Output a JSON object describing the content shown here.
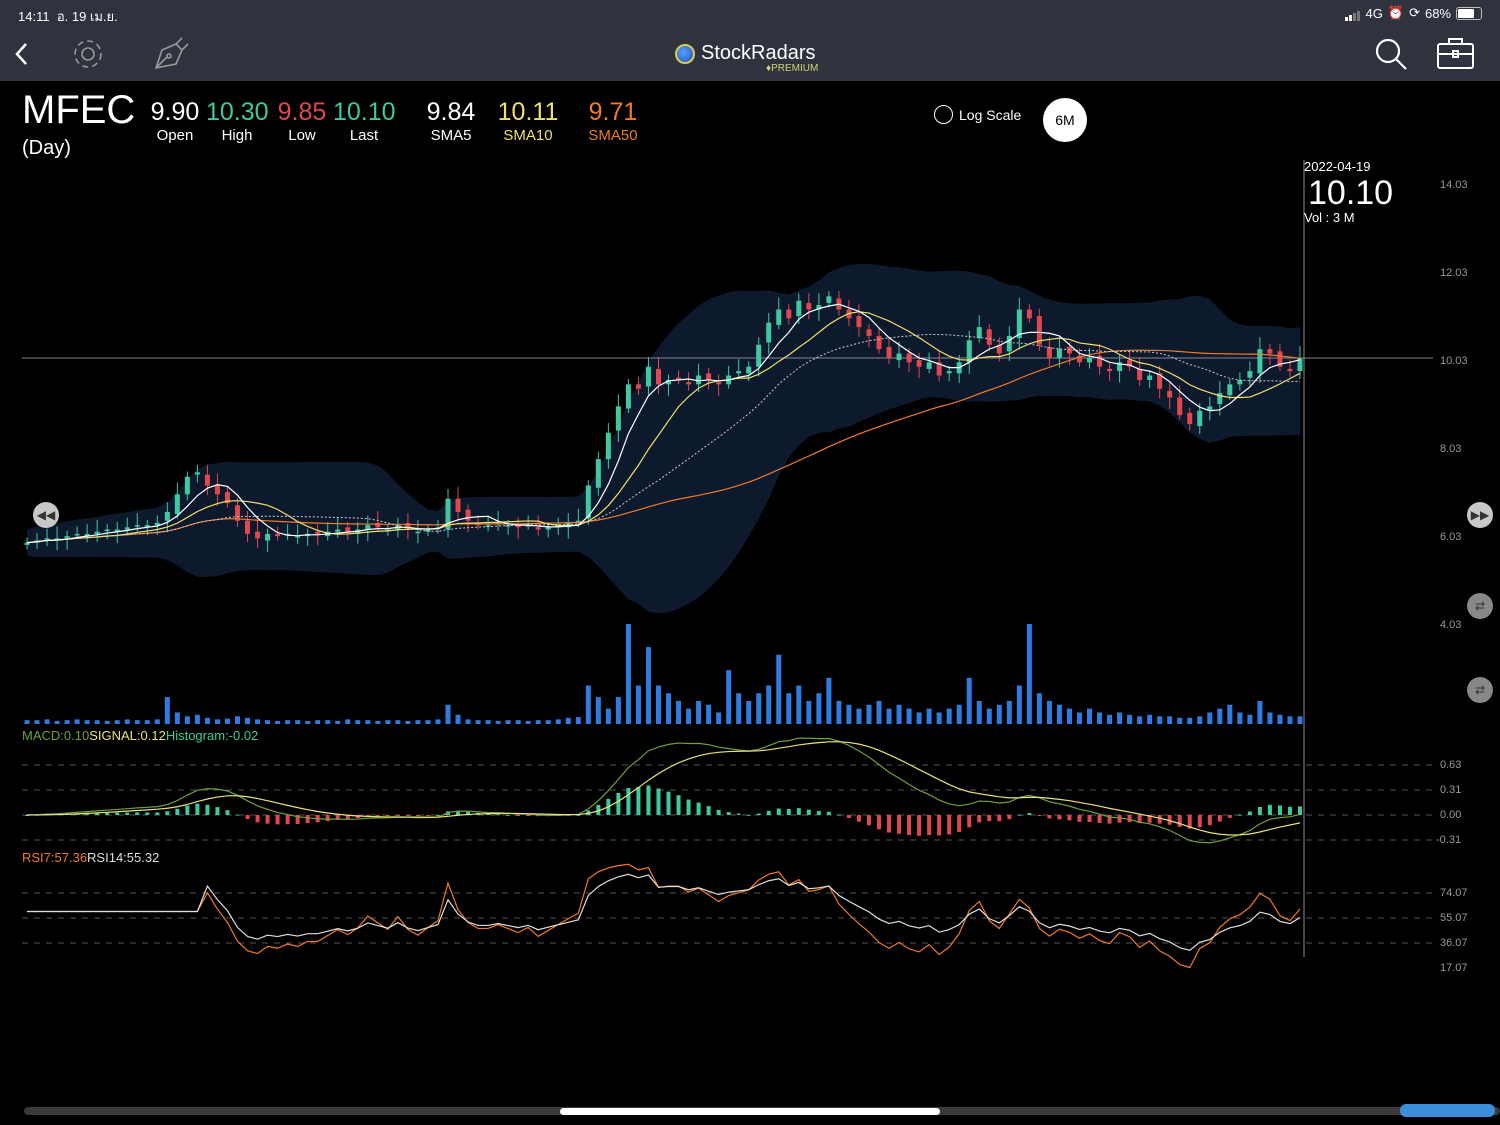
{
  "status": {
    "time": "14:11",
    "date": "อ. 19 เม.ย.",
    "network": "4G",
    "battery": "68%"
  },
  "nav": {
    "app_name": "StockRadars",
    "badge": "PREMIUM"
  },
  "quote": {
    "symbol": "MFEC",
    "period": "(Day)",
    "open": {
      "value": "9.90",
      "label": "Open"
    },
    "high": {
      "value": "10.30",
      "label": "High"
    },
    "low": {
      "value": "9.85",
      "label": "Low"
    },
    "last": {
      "value": "10.10",
      "label": "Last"
    },
    "sma5": {
      "value": "9.84",
      "label": "SMA5"
    },
    "sma10": {
      "value": "10.11",
      "label": "SMA10"
    },
    "sma50": {
      "value": "9.71",
      "label": "SMA50"
    }
  },
  "controls": {
    "log_scale": "Log Scale",
    "range": "6M"
  },
  "crosshair": {
    "date": "2022-04-19",
    "price": "10.10",
    "volume": "Vol    : 3 M"
  },
  "indicators": {
    "macd": "MACD:0.10",
    "signal": "SIGNAL:0.12",
    "histogram": "Histogram:-0.02",
    "rsi7": "RSI7:57.36",
    "rsi14": "RSI14:55.32"
  },
  "colors": {
    "up": "#3fc9a1",
    "down": "#e0474f",
    "sma5": "#ffffff",
    "sma10": "#f0e06a",
    "sma50": "#f07a2a",
    "volume": "#2f7be0",
    "band": "#0d1a2e"
  },
  "chart_data": {
    "type": "candlestick",
    "price_axis": [
      "14.03",
      "12.03",
      "10.03",
      "8.03",
      "6.03",
      "4.03"
    ],
    "price_range": [
      3.0,
      14.5
    ],
    "macd_axis": [
      "0.63",
      "0.31",
      "0.00",
      "-0.31"
    ],
    "rsi_axis": [
      "74.07",
      "55.07",
      "36.07",
      "17.07"
    ],
    "close": [
      5.9,
      5.95,
      6.0,
      6.0,
      6.05,
      6.1,
      6.1,
      6.15,
      6.2,
      6.2,
      6.25,
      6.3,
      6.3,
      6.35,
      6.6,
      7.0,
      7.4,
      7.5,
      7.2,
      7.0,
      6.8,
      6.4,
      6.1,
      6.0,
      6.1,
      6.05,
      6.1,
      6.05,
      6.1,
      6.1,
      6.15,
      6.2,
      6.15,
      6.2,
      6.3,
      6.25,
      6.2,
      6.3,
      6.2,
      6.15,
      6.2,
      6.25,
      6.9,
      6.6,
      6.4,
      6.3,
      6.3,
      6.35,
      6.3,
      6.25,
      6.3,
      6.2,
      6.25,
      6.3,
      6.35,
      6.4,
      7.2,
      7.8,
      8.4,
      9.0,
      9.5,
      9.4,
      9.9,
      9.5,
      9.6,
      9.6,
      9.5,
      9.7,
      9.6,
      9.5,
      9.7,
      9.8,
      9.9,
      10.4,
      10.9,
      11.2,
      11.0,
      11.4,
      11.2,
      11.3,
      11.5,
      11.2,
      11.0,
      10.8,
      10.6,
      10.3,
      10.1,
      10.2,
      10.0,
      9.9,
      10.0,
      9.7,
      9.8,
      10.0,
      10.5,
      10.8,
      10.4,
      10.2,
      10.6,
      11.2,
      11.0,
      10.4,
      10.1,
      10.3,
      10.2,
      10.0,
      10.1,
      9.9,
      9.8,
      10.0,
      9.9,
      9.6,
      9.7,
      9.4,
      9.2,
      8.8,
      8.6,
      8.9,
      9.0,
      9.3,
      9.5,
      9.6,
      9.8,
      10.3,
      10.2,
      9.9,
      9.8,
      10.1
    ],
    "volume_m": [
      0.5,
      0.5,
      0.6,
      0.4,
      0.5,
      0.6,
      0.5,
      0.5,
      0.4,
      0.5,
      0.6,
      0.5,
      0.5,
      0.6,
      3.5,
      1.5,
      1.0,
      1.2,
      0.8,
      0.6,
      0.7,
      1.0,
      0.8,
      0.6,
      0.5,
      0.4,
      0.5,
      0.5,
      0.4,
      0.5,
      0.5,
      0.4,
      0.6,
      0.5,
      0.5,
      0.4,
      0.5,
      0.5,
      0.4,
      0.5,
      0.5,
      0.6,
      2.5,
      1.2,
      0.6,
      0.5,
      0.5,
      0.4,
      0.5,
      0.5,
      0.4,
      0.5,
      0.5,
      0.6,
      0.8,
      0.9,
      5.0,
      3.5,
      2.0,
      3.5,
      13.0,
      5.0,
      10.0,
      5.0,
      4.0,
      3.0,
      2.0,
      3.0,
      2.5,
      1.5,
      7.0,
      4.0,
      3.0,
      4.0,
      5.0,
      9.0,
      4.0,
      5.0,
      3.0,
      4.0,
      6.0,
      3.0,
      2.5,
      2.0,
      2.5,
      3.0,
      2.0,
      2.5,
      2.0,
      1.5,
      2.0,
      1.5,
      2.0,
      2.5,
      6.0,
      3.0,
      2.0,
      2.5,
      3.0,
      5.0,
      13.0,
      4.0,
      3.0,
      2.5,
      2.0,
      1.5,
      2.0,
      1.5,
      1.2,
      1.5,
      1.2,
      1.0,
      1.2,
      1.0,
      1.0,
      0.8,
      0.8,
      1.0,
      1.5,
      2.0,
      2.5,
      1.5,
      1.2,
      3.0,
      1.5,
      1.2,
      1.0,
      1.0
    ]
  }
}
